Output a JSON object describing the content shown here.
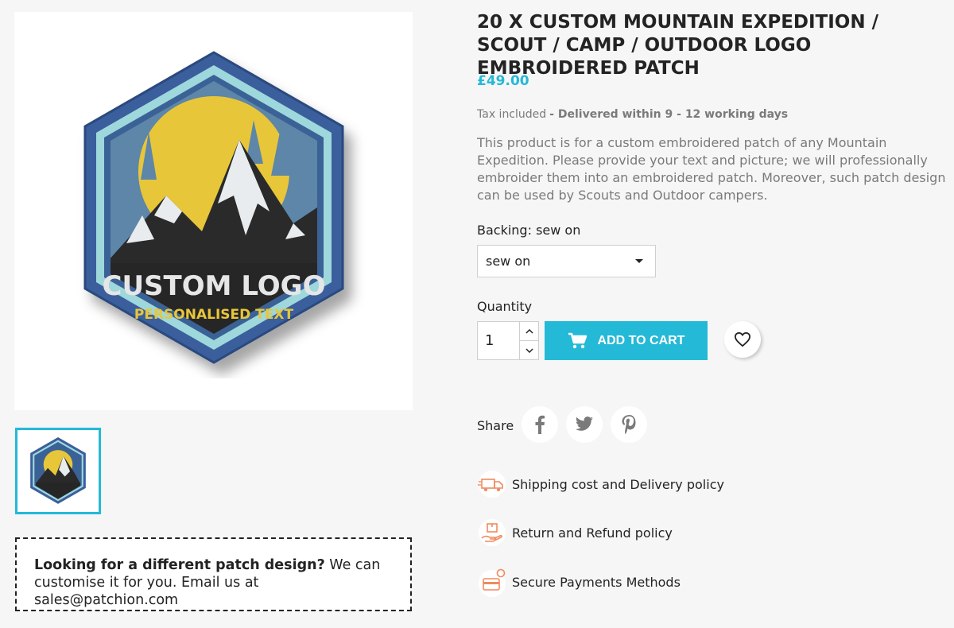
{
  "product": {
    "title": "20 X CUSTOM MOUNTAIN EXPEDITION / SCOUT / CAMP / OUTDOOR LOGO EMBROIDERED PATCH",
    "price": "£49.00",
    "tax_label": "Tax included",
    "delivery": "- Delivered within 9 - 12 working days",
    "description": "This product is for a custom embroidered patch of any Mountain Expedition. Please provide your text and picture; we will professionally embroider them into an embroidered patch. Moreover, such patch design can be used by Scouts and Outdoor campers."
  },
  "patch": {
    "main_text": "CUSTOM LOGO",
    "sub_text": "PERSONALISED TEXT"
  },
  "options": {
    "backing_label": "Backing: sew on",
    "backing_selected": "sew on",
    "quantity_label": "Quantity",
    "quantity_value": "1"
  },
  "actions": {
    "add_to_cart": "ADD TO CART"
  },
  "share": {
    "label": "Share"
  },
  "policies": [
    {
      "label": "Shipping cost and Delivery policy",
      "icon": "truck-icon"
    },
    {
      "label": "Return and Refund policy",
      "icon": "return-box-icon"
    },
    {
      "label": "Secure Payments Methods",
      "icon": "credit-card-icon"
    }
  ],
  "promo": {
    "bold": "Looking for a different patch design?",
    "text": " We can customise it for you. Email us at sales@patchion.com"
  },
  "colors": {
    "accent": "#24b9d7",
    "text": "#232323",
    "muted": "#7a7a7a",
    "policy_icon": "#f08a5d"
  }
}
